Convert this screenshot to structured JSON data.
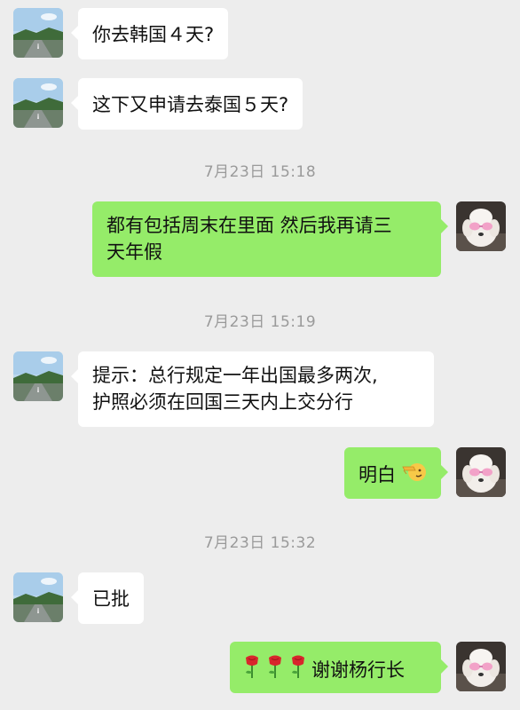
{
  "messages": {
    "m1": {
      "text": "你去韩国４天?"
    },
    "m2": {
      "text": "这下又申请去泰国５天?"
    },
    "t1": {
      "text": "7月23日 15:18"
    },
    "m3": {
      "line1": "都有包括周末在里面 然后我再请三",
      "line2": "天年假"
    },
    "t2": {
      "text": "7月23日 15:19"
    },
    "m4": {
      "line1": "提示：总行规定一年出国最多两次,",
      "line2": "护照必须在回国三天内上交分行"
    },
    "m5": {
      "text": "明白",
      "emoji": "saluting-face"
    },
    "t3": {
      "text": "7月23日 15:32"
    },
    "m6": {
      "text": "已批"
    },
    "m7": {
      "emoji": [
        "rose",
        "rose",
        "rose"
      ],
      "text": "谢谢杨行长"
    }
  },
  "colors": {
    "background": "#ededed",
    "sent_bubble": "#95ec69",
    "received_bubble": "#ffffff",
    "timestamp": "#9a9a9a"
  }
}
